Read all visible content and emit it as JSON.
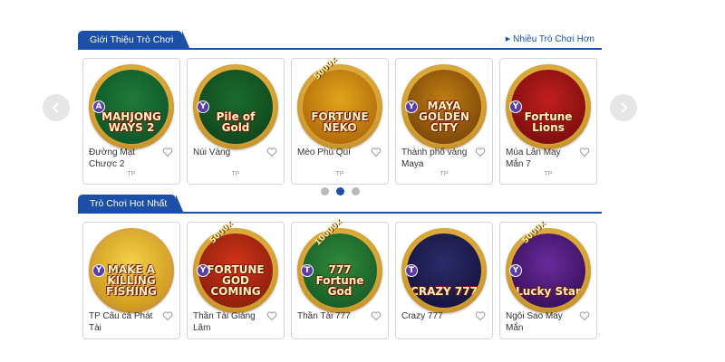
{
  "intro_section": {
    "tab_label": "Giới Thiệu Trò Chơi",
    "more_label": "Nhiều Trò Chơi Hơn",
    "games": [
      {
        "name": "Đường Mạt Chược 2",
        "art_title": "MAHJONG WAYS 2",
        "provider": "TP",
        "badge": "A",
        "multiplier": "",
        "colors": [
          "#1f7a3a",
          "#0b4d24"
        ]
      },
      {
        "name": "Núi Vàng",
        "art_title": "Pile of Gold",
        "provider": "TP",
        "badge": "Y",
        "multiplier": "",
        "colors": [
          "#1a6b2d",
          "#0e3e1a"
        ]
      },
      {
        "name": "Mèo Phú Quí",
        "art_title": "FORTUNE NEKO",
        "provider": "TP",
        "badge": "",
        "multiplier": "5000x",
        "colors": [
          "#e2a41b",
          "#a45c06"
        ]
      },
      {
        "name": "Thành phố vàng Maya",
        "art_title": "MAYA GOLDEN CITY",
        "provider": "TP",
        "badge": "Y",
        "multiplier": "",
        "colors": [
          "#c07d13",
          "#6b3a06"
        ]
      },
      {
        "name": "Múa Lân May Mắn 7",
        "art_title": "Fortune Lions",
        "provider": "TP",
        "badge": "Y",
        "multiplier": "",
        "colors": [
          "#c11e1e",
          "#6b0a0a"
        ]
      }
    ]
  },
  "hot_section": {
    "tab_label": "Trò Chơi Hot Nhất",
    "games": [
      {
        "name": "TP Câu cá Phát Tài",
        "art_title": "MAKE A KILLING FISHING",
        "provider": "",
        "badge": "Y",
        "multiplier": "",
        "colors": [
          "#f4d24a",
          "#c68d10"
        ]
      },
      {
        "name": "Thần Tài Giáng Lâm",
        "art_title": "FORTUNE GOD COMING",
        "provider": "",
        "badge": "Y",
        "multiplier": "5000x",
        "colors": [
          "#d13418",
          "#7a1a0a"
        ]
      },
      {
        "name": "Thần Tài 777",
        "art_title": "777 Fortune God",
        "provider": "",
        "badge": "T",
        "multiplier": "10000x",
        "colors": [
          "#2f8a3a",
          "#135223"
        ]
      },
      {
        "name": "Crazy 777",
        "art_title": "CRAZY 777",
        "provider": "",
        "badge": "T",
        "multiplier": "",
        "colors": [
          "#2b2b6b",
          "#0f0f33"
        ]
      },
      {
        "name": "Ngôi Sao May Mắn",
        "art_title": "Lucky Star",
        "provider": "",
        "badge": "Y",
        "multiplier": "5000x",
        "colors": [
          "#6a2a9b",
          "#2b0b4d"
        ]
      }
    ]
  },
  "carousel": {
    "page_count": 3,
    "active_page": 2
  },
  "icons": {
    "prev": "chevron-left-icon",
    "next": "chevron-right-icon",
    "favorite": "heart-icon",
    "more": "triangle-right-icon"
  },
  "colors": {
    "accent": "#1b4fa8",
    "heart": "#999999",
    "dot_inactive": "#b9b9b9"
  }
}
